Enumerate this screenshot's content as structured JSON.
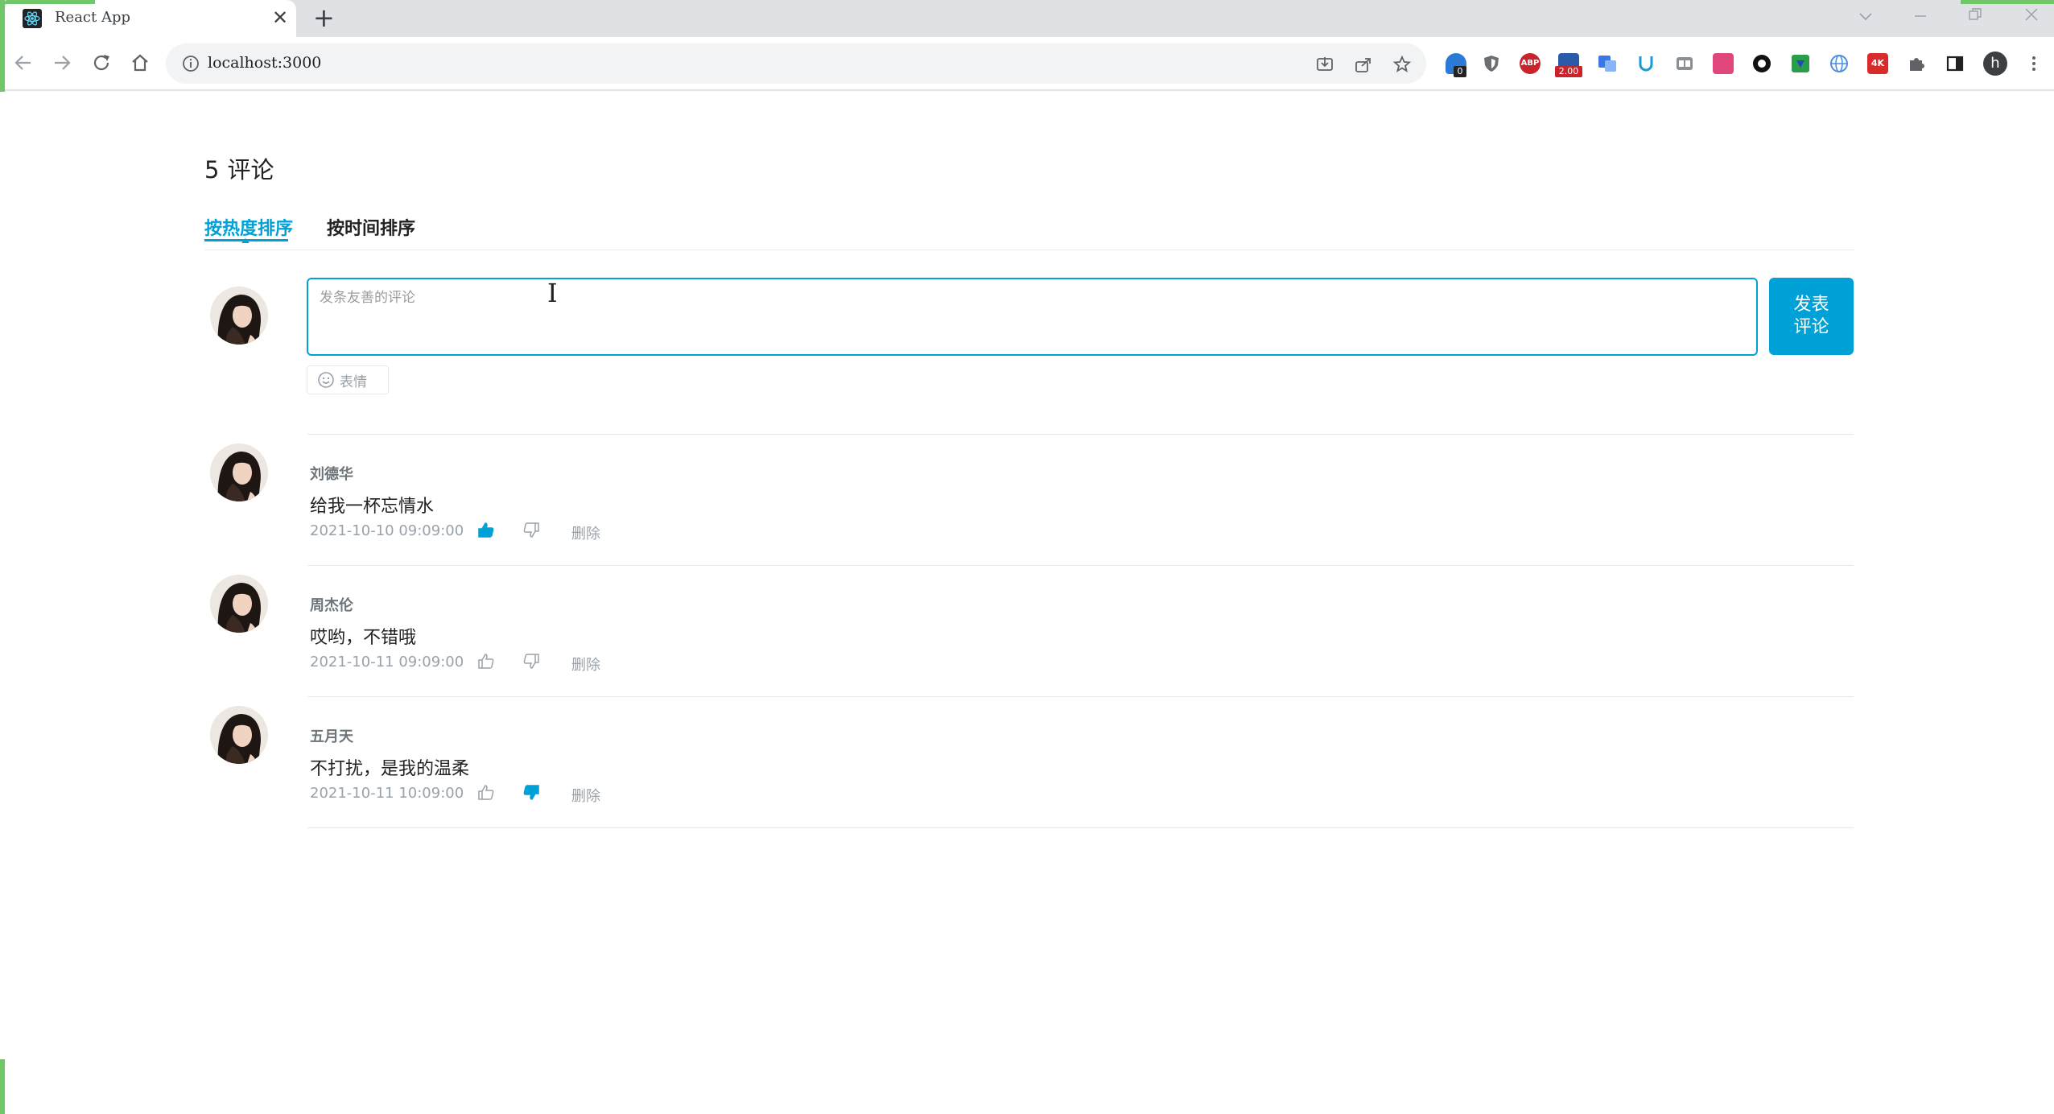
{
  "browser": {
    "tab_title": "React App",
    "tab_close": "✕",
    "new_tab": "+",
    "url": "localhost:3000",
    "extensions": [
      "ghost-ext",
      "shield-ext",
      "abp-ext",
      "price-ext",
      "translate-ext",
      "magnet-ext",
      "tab-ext",
      "pink-ext",
      "circle-ext",
      "download-ext",
      "globe-ext",
      "4k-ext",
      "puzzle-ext",
      "sidebar-ext",
      "profile"
    ],
    "badge_count": "0",
    "price_badge": "2.00",
    "abp_label": "ABP",
    "k4_label": "4K",
    "profile_letter": "h"
  },
  "comments_section": {
    "count": "5",
    "count_label": "评论",
    "sort_tabs": [
      "按热度排序",
      "按时间排序"
    ],
    "active_tab": 0,
    "input": {
      "placeholder": "发条友善的评论",
      "value": ""
    },
    "publish_label_line1": "发表",
    "publish_label_line2": "评论",
    "emoji_label": "表情"
  },
  "comments": [
    {
      "user": "刘德华",
      "text": "给我一杯忘情水",
      "time": "2021-10-10 09:09:00",
      "attitude": "like",
      "delete_label": "删除"
    },
    {
      "user": "周杰伦",
      "text": "哎哟，不错哦",
      "time": "2021-10-11 09:09:00",
      "attitude": "none",
      "delete_label": "删除"
    },
    {
      "user": "五月天",
      "text": "不打扰，是我的温柔",
      "time": "2021-10-11 10:09:00",
      "attitude": "dislike",
      "delete_label": "删除"
    }
  ],
  "colors": {
    "accent": "#00a1d6",
    "muted": "#99a2aa",
    "border": "#e5e9ef"
  }
}
